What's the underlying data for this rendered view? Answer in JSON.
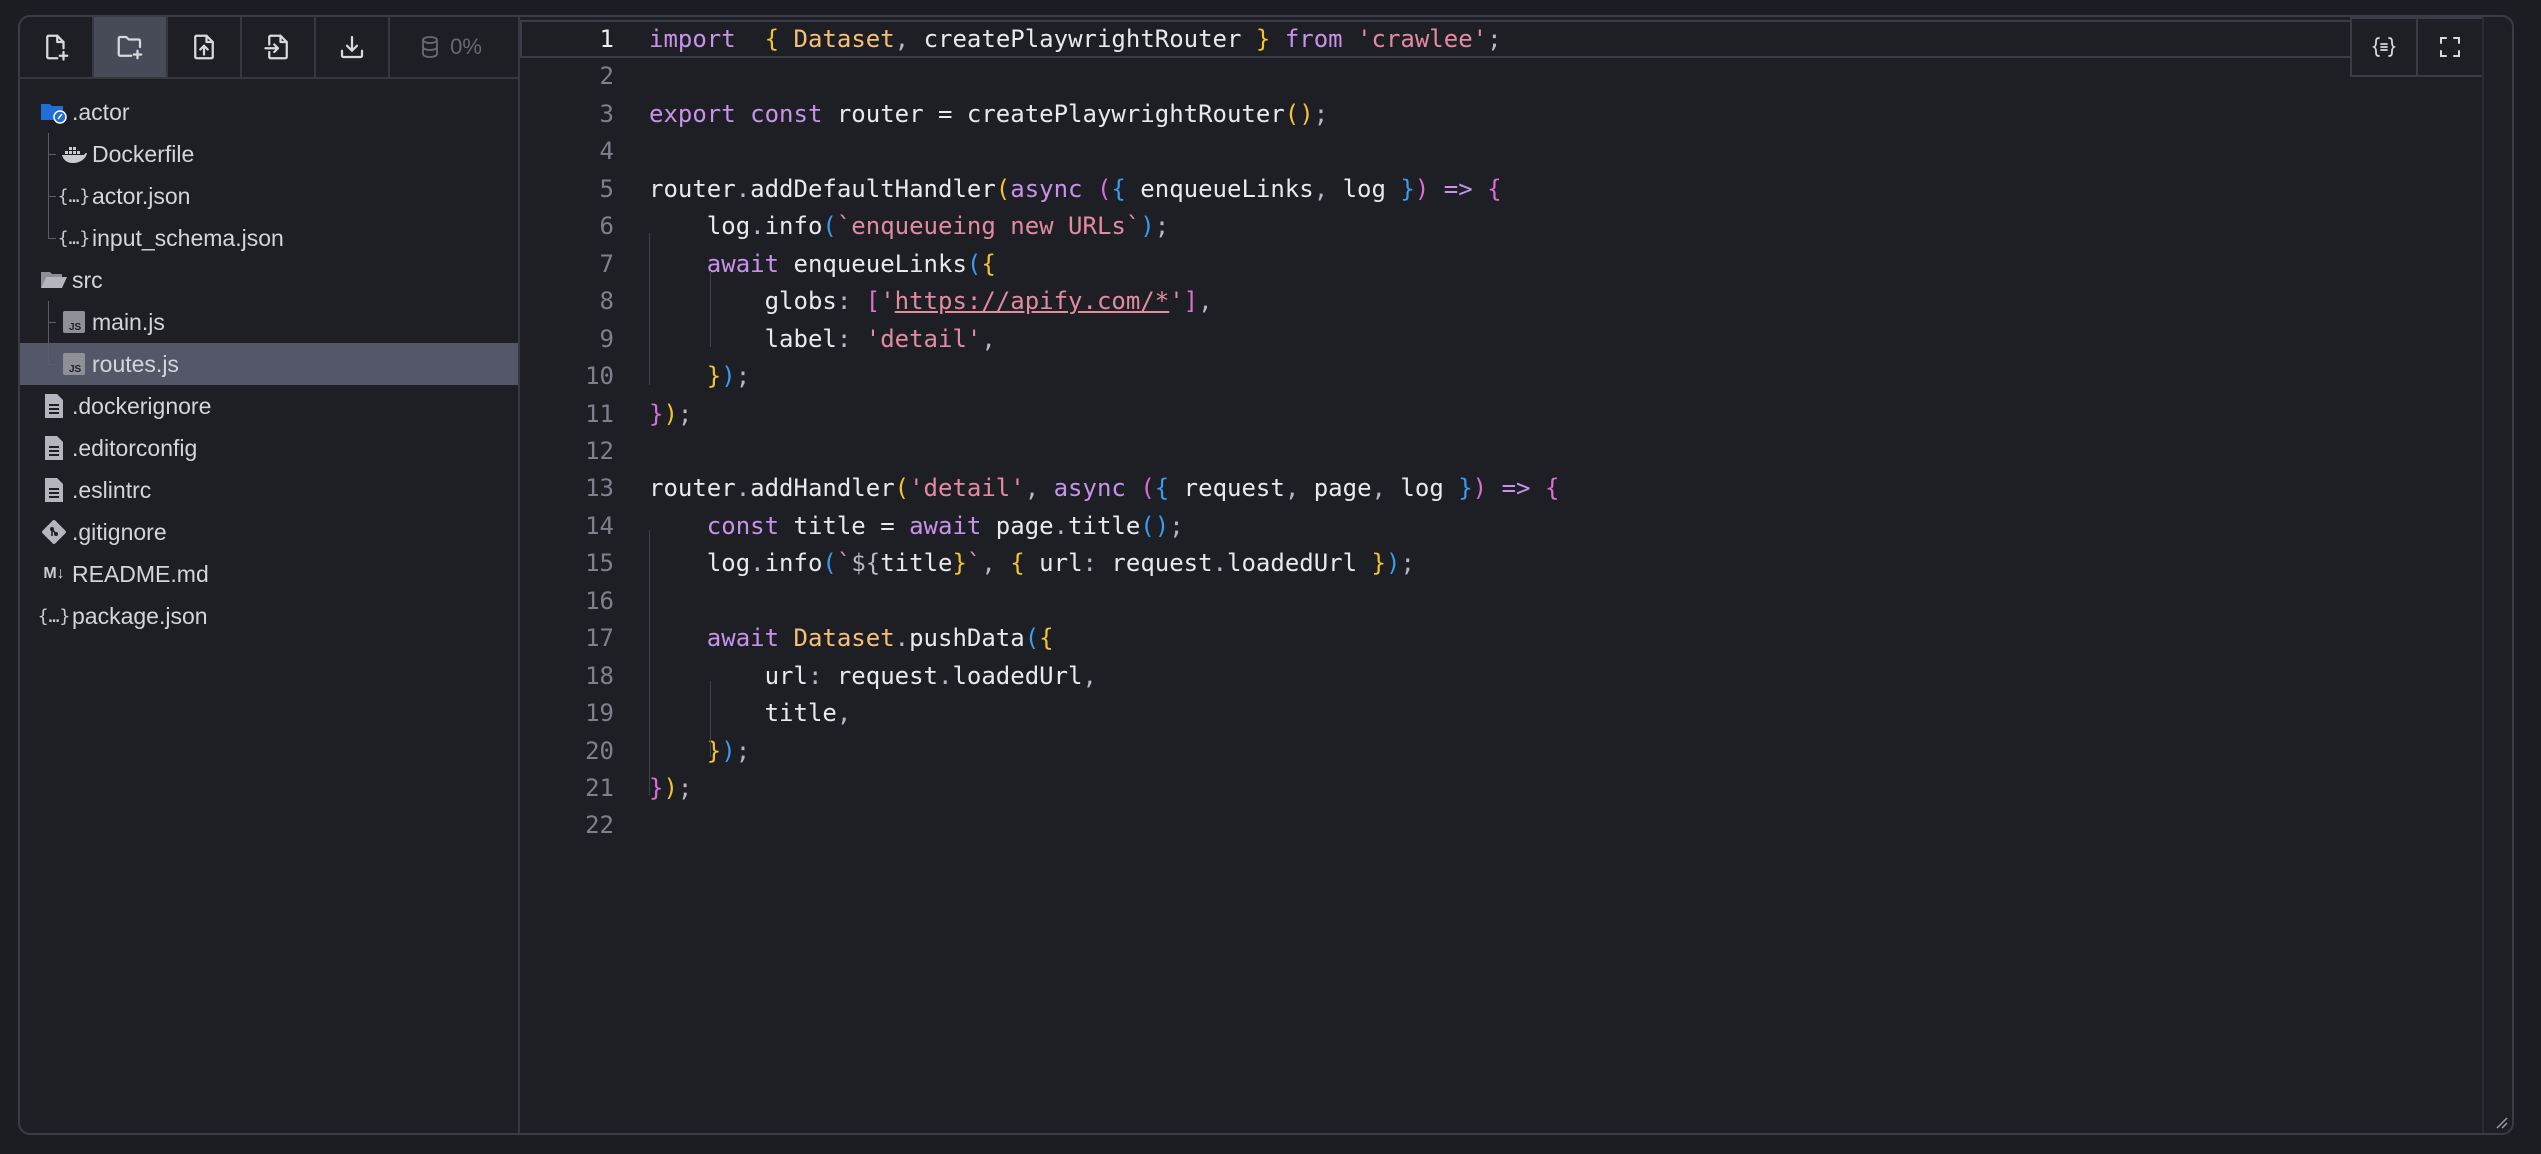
{
  "toolbar": {
    "buttons": [
      "new-file",
      "new-folder",
      "upload-file",
      "import-file",
      "download"
    ],
    "storage_percent": "0%"
  },
  "tree": [
    {
      "label": ".actor",
      "icon": "folder-actor-icon",
      "level": 0
    },
    {
      "label": "Dockerfile",
      "icon": "docker-icon",
      "level": 1
    },
    {
      "label": "actor.json",
      "icon": "json-icon",
      "level": 1
    },
    {
      "label": "input_schema.json",
      "icon": "json-icon",
      "level": 1
    },
    {
      "label": "src",
      "icon": "folder-open-icon",
      "level": 0
    },
    {
      "label": "main.js",
      "icon": "js-icon",
      "level": 1
    },
    {
      "label": "routes.js",
      "icon": "js-icon",
      "level": 1,
      "selected": true
    },
    {
      "label": ".dockerignore",
      "icon": "file-icon",
      "level": 0
    },
    {
      "label": ".editorconfig",
      "icon": "file-icon",
      "level": 0
    },
    {
      "label": ".eslintrc",
      "icon": "file-icon",
      "level": 0
    },
    {
      "label": ".gitignore",
      "icon": "git-icon",
      "level": 0
    },
    {
      "label": "README.md",
      "icon": "markdown-icon",
      "level": 0
    },
    {
      "label": "package.json",
      "icon": "json-icon",
      "level": 0
    }
  ],
  "editor": {
    "current_line": 1,
    "line_numbers": [
      "1",
      "2",
      "3",
      "4",
      "5",
      "6",
      "7",
      "8",
      "9",
      "10",
      "11",
      "12",
      "13",
      "14",
      "15",
      "16",
      "17",
      "18",
      "19",
      "20",
      "21",
      "22"
    ],
    "lines": [
      [
        [
          "kw",
          "import"
        ],
        [
          "",
          "  "
        ],
        [
          "br1",
          "{"
        ],
        [
          "",
          " "
        ],
        [
          "cls",
          "Dataset"
        ],
        [
          "pun",
          ","
        ],
        [
          "",
          " createPlaywrightRouter "
        ],
        [
          "br1",
          "}"
        ],
        [
          "",
          " "
        ],
        [
          "kw",
          "from"
        ],
        [
          "",
          " "
        ],
        [
          "str",
          "'crawlee'"
        ],
        [
          "pun",
          ";"
        ]
      ],
      [],
      [
        [
          "kw",
          "export"
        ],
        [
          "",
          " "
        ],
        [
          "kw",
          "const"
        ],
        [
          "",
          " router = createPlaywrightRouter"
        ],
        [
          "br1",
          "()"
        ],
        [
          "pun",
          ";"
        ]
      ],
      [],
      [
        [
          "",
          "router"
        ],
        [
          "pun",
          "."
        ],
        [
          "",
          "addDefaultHandler"
        ],
        [
          "br1",
          "("
        ],
        [
          "kw",
          "async"
        ],
        [
          "",
          " "
        ],
        [
          "br2",
          "("
        ],
        [
          "br3",
          "{"
        ],
        [
          "",
          " enqueueLinks"
        ],
        [
          "pun",
          ","
        ],
        [
          "",
          " log "
        ],
        [
          "br3",
          "}"
        ],
        [
          "br2",
          ")"
        ],
        [
          "",
          " "
        ],
        [
          "kw",
          "=>"
        ],
        [
          "",
          " "
        ],
        [
          "br2",
          "{"
        ]
      ],
      [
        [
          "",
          "    log"
        ],
        [
          "pun",
          "."
        ],
        [
          "",
          "info"
        ],
        [
          "br3",
          "("
        ],
        [
          "str",
          "`enqueueing new URLs`"
        ],
        [
          "br3",
          ")"
        ],
        [
          "pun",
          ";"
        ]
      ],
      [
        [
          "",
          "    "
        ],
        [
          "kw",
          "await"
        ],
        [
          "",
          " enqueueLinks"
        ],
        [
          "br3",
          "("
        ],
        [
          "br1",
          "{"
        ]
      ],
      [
        [
          "",
          "        globs"
        ],
        [
          "pun",
          ":"
        ],
        [
          "",
          " "
        ],
        [
          "br2",
          "["
        ],
        [
          "str",
          "'"
        ],
        [
          "str url",
          "https://apify.com/*"
        ],
        [
          "str",
          "'"
        ],
        [
          "br2",
          "]"
        ],
        [
          "pun",
          ","
        ]
      ],
      [
        [
          "",
          "        label"
        ],
        [
          "pun",
          ":"
        ],
        [
          "",
          " "
        ],
        [
          "str",
          "'detail'"
        ],
        [
          "pun",
          ","
        ]
      ],
      [
        [
          "",
          "    "
        ],
        [
          "br1",
          "}"
        ],
        [
          "br3",
          ")"
        ],
        [
          "pun",
          ";"
        ]
      ],
      [
        [
          "br2",
          "}"
        ],
        [
          "br1",
          ")"
        ],
        [
          "pun",
          ";"
        ]
      ],
      [],
      [
        [
          "",
          "router"
        ],
        [
          "pun",
          "."
        ],
        [
          "",
          "addHandler"
        ],
        [
          "br1",
          "("
        ],
        [
          "str",
          "'detail'"
        ],
        [
          "pun",
          ","
        ],
        [
          "",
          " "
        ],
        [
          "kw",
          "async"
        ],
        [
          "",
          " "
        ],
        [
          "br2",
          "("
        ],
        [
          "br3",
          "{"
        ],
        [
          "",
          " request"
        ],
        [
          "pun",
          ","
        ],
        [
          "",
          " page"
        ],
        [
          "pun",
          ","
        ],
        [
          "",
          " log "
        ],
        [
          "br3",
          "}"
        ],
        [
          "br2",
          ")"
        ],
        [
          "",
          " "
        ],
        [
          "kw",
          "=>"
        ],
        [
          "",
          " "
        ],
        [
          "br2",
          "{"
        ]
      ],
      [
        [
          "",
          "    "
        ],
        [
          "kw",
          "const"
        ],
        [
          "",
          " title = "
        ],
        [
          "kw",
          "await"
        ],
        [
          "",
          " page"
        ],
        [
          "pun",
          "."
        ],
        [
          "",
          "title"
        ],
        [
          "br3",
          "()"
        ],
        [
          "pun",
          ";"
        ]
      ],
      [
        [
          "",
          "    log"
        ],
        [
          "pun",
          "."
        ],
        [
          "",
          "info"
        ],
        [
          "br3",
          "("
        ],
        [
          "str",
          "`"
        ],
        [
          "pun",
          "${"
        ],
        [
          "",
          "title"
        ],
        [
          "br1",
          "}"
        ],
        [
          "str",
          "`"
        ],
        [
          "pun",
          ","
        ],
        [
          "",
          " "
        ],
        [
          "br1",
          "{"
        ],
        [
          "",
          " url"
        ],
        [
          "pun",
          ":"
        ],
        [
          "",
          " request"
        ],
        [
          "pun",
          "."
        ],
        [
          "",
          "loadedUrl "
        ],
        [
          "br1",
          "}"
        ],
        [
          "br3",
          ")"
        ],
        [
          "pun",
          ";"
        ]
      ],
      [],
      [
        [
          "",
          "    "
        ],
        [
          "kw",
          "await"
        ],
        [
          "",
          " "
        ],
        [
          "cls",
          "Dataset"
        ],
        [
          "pun",
          "."
        ],
        [
          "",
          "pushData"
        ],
        [
          "br3",
          "("
        ],
        [
          "br1",
          "{"
        ]
      ],
      [
        [
          "",
          "        url"
        ],
        [
          "pun",
          ":"
        ],
        [
          "",
          " request"
        ],
        [
          "pun",
          "."
        ],
        [
          "",
          "loadedUrl"
        ],
        [
          "pun",
          ","
        ]
      ],
      [
        [
          "",
          "        title"
        ],
        [
          "pun",
          ","
        ]
      ],
      [
        [
          "",
          "    "
        ],
        [
          "br1",
          "}"
        ],
        [
          "br3",
          ")"
        ],
        [
          "pun",
          ";"
        ]
      ],
      [
        [
          "br2",
          "}"
        ],
        [
          "br1",
          ")"
        ],
        [
          "pun",
          ";"
        ]
      ],
      []
    ]
  }
}
